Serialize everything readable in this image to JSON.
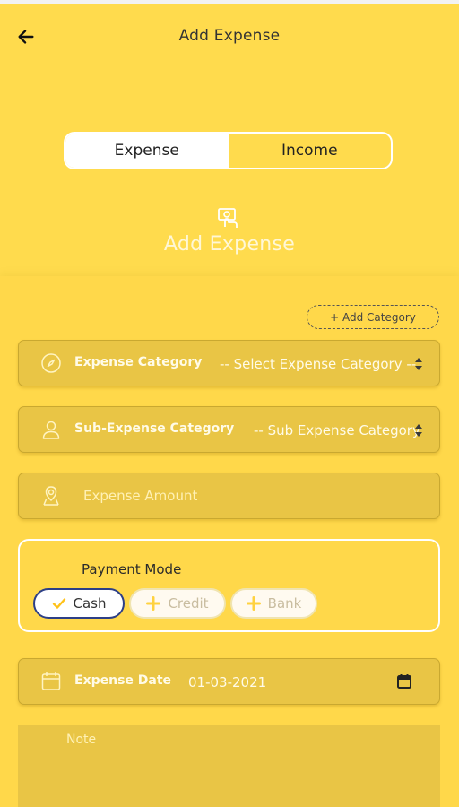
{
  "header": {
    "title": "Add Expense"
  },
  "toggle": {
    "expense_label": "Expense",
    "income_label": "Income",
    "active": "Expense"
  },
  "hero": {
    "title": "Add Expense"
  },
  "add_category": {
    "label": "+ Add Category"
  },
  "expense_category": {
    "label": "Expense Category",
    "value": "-- Select Expense Category --"
  },
  "sub_expense_category": {
    "label": "Sub-Expense Category",
    "value": "-- Sub Expense Category --"
  },
  "expense_amount": {
    "placeholder": "Expense Amount"
  },
  "payment_mode": {
    "title": "Payment Mode",
    "options": [
      {
        "label": "Cash",
        "selected": true
      },
      {
        "label": "Credit",
        "selected": false
      },
      {
        "label": "Bank",
        "selected": false
      }
    ]
  },
  "expense_date": {
    "label": "Expense Date",
    "value": "01-03-2021"
  },
  "note": {
    "placeholder": "Note"
  },
  "colors": {
    "background": "#FFDB4D",
    "field": "#E9C545",
    "accent": "#2d3f87",
    "plus": "#FFD23F"
  }
}
